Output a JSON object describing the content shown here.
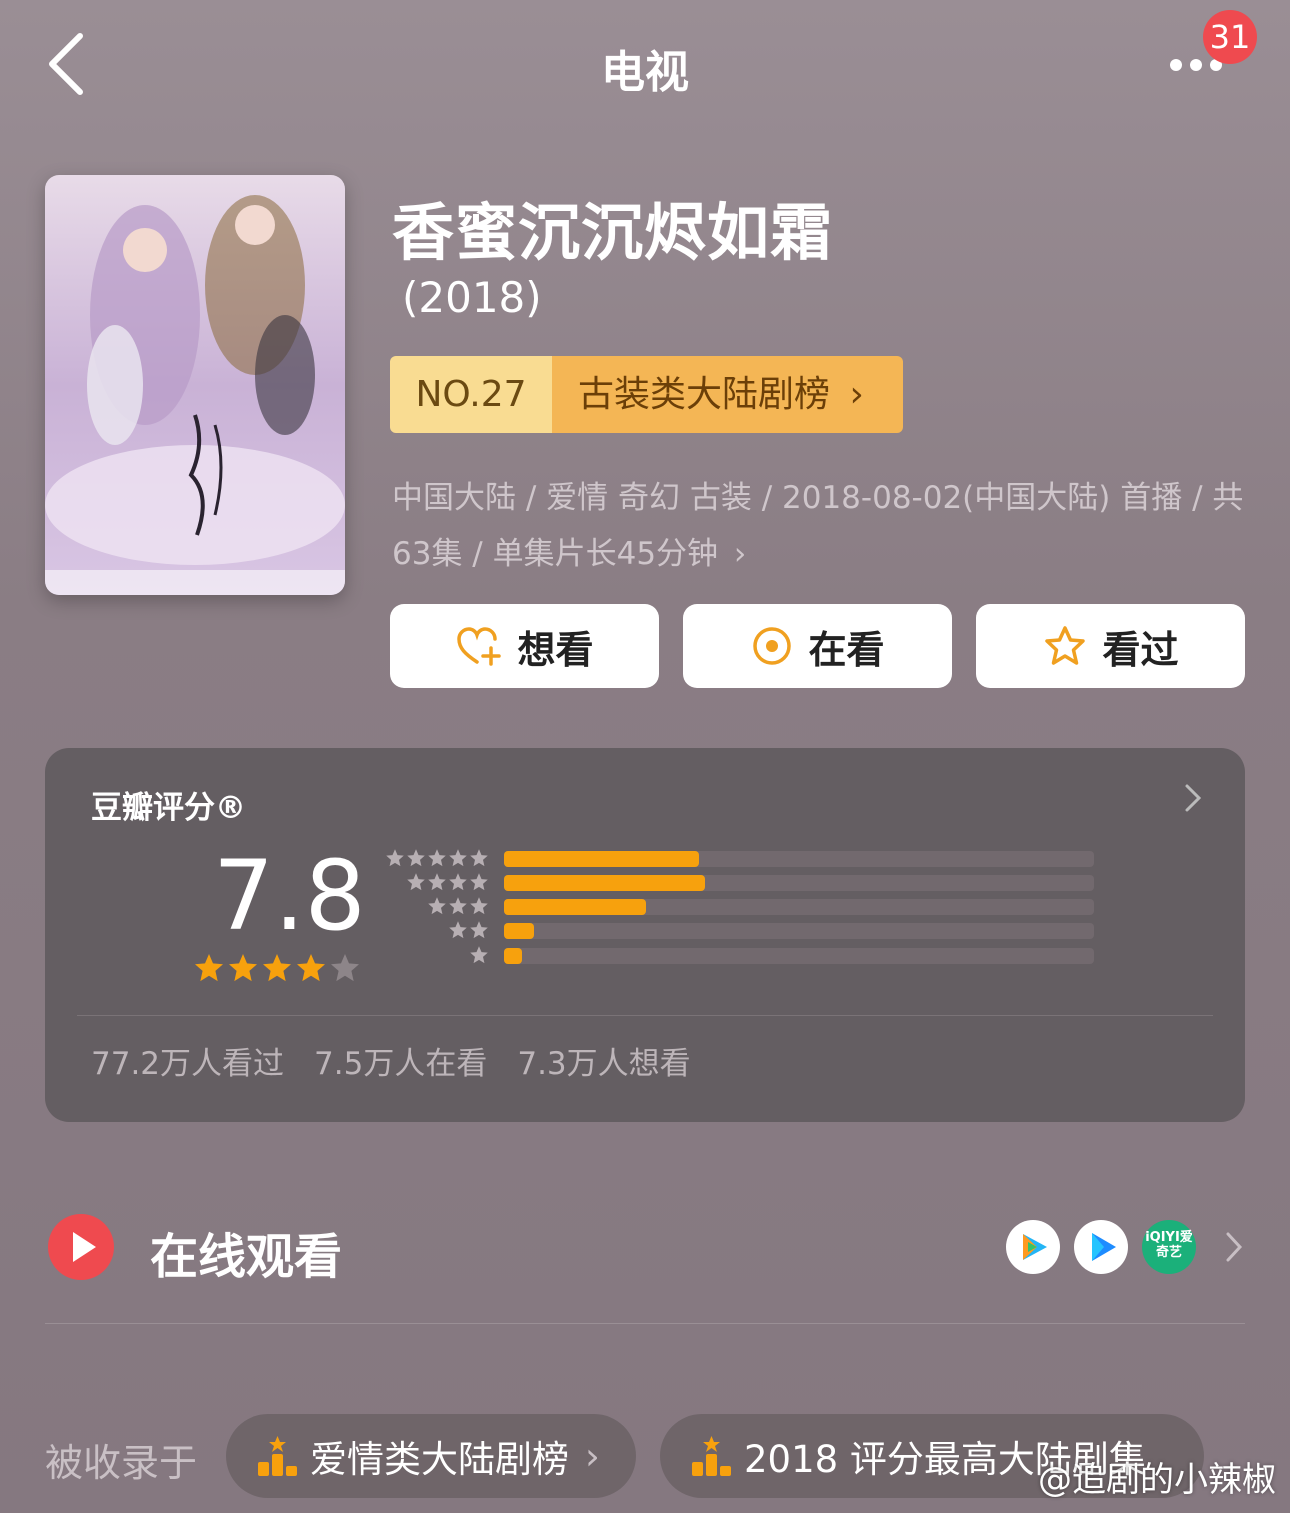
{
  "nav": {
    "title": "电视",
    "badge": "31"
  },
  "show": {
    "title": "香蜜沉沉烬如霜",
    "year": "(2018)",
    "rank_no": "NO.27",
    "rank_list": "古装类大陆剧榜",
    "meta": "中国大陆 / 爱情 奇幻 古装 / 2018-08-02(中国大陆) 首播 / 共63集 / 单集片长45分钟"
  },
  "actions": {
    "want": "想看",
    "watching": "在看",
    "watched": "看过"
  },
  "rating": {
    "title": "豆瓣评分®",
    "score": "7.8",
    "star_value": 4,
    "breakdown": [
      {
        "stars": 5,
        "fraction": 0.33
      },
      {
        "stars": 4,
        "fraction": 0.34
      },
      {
        "stars": 3,
        "fraction": 0.24
      },
      {
        "stars": 2,
        "fraction": 0.05
      },
      {
        "stars": 1,
        "fraction": 0.03
      }
    ],
    "watched": "77.2万人看过",
    "watching": "7.5万人在看",
    "want": "7.3万人想看"
  },
  "watch": {
    "label": "在线观看",
    "platforms": [
      "tencent-video-icon",
      "youku-icon",
      "iqiyi-icon"
    ],
    "iqiyi_text": "iQIYI爱奇艺"
  },
  "collections": {
    "label": "被收录于",
    "items": [
      "爱情类大陆剧榜",
      "2018 评分最高大陆剧集"
    ]
  },
  "watermark": "@追剧的小辣椒",
  "colors": {
    "accent": "#f7a10d",
    "badge": "#ef4a4f",
    "rank_no_bg": "#f9dc92",
    "rank_list_bg": "#f4b655"
  }
}
